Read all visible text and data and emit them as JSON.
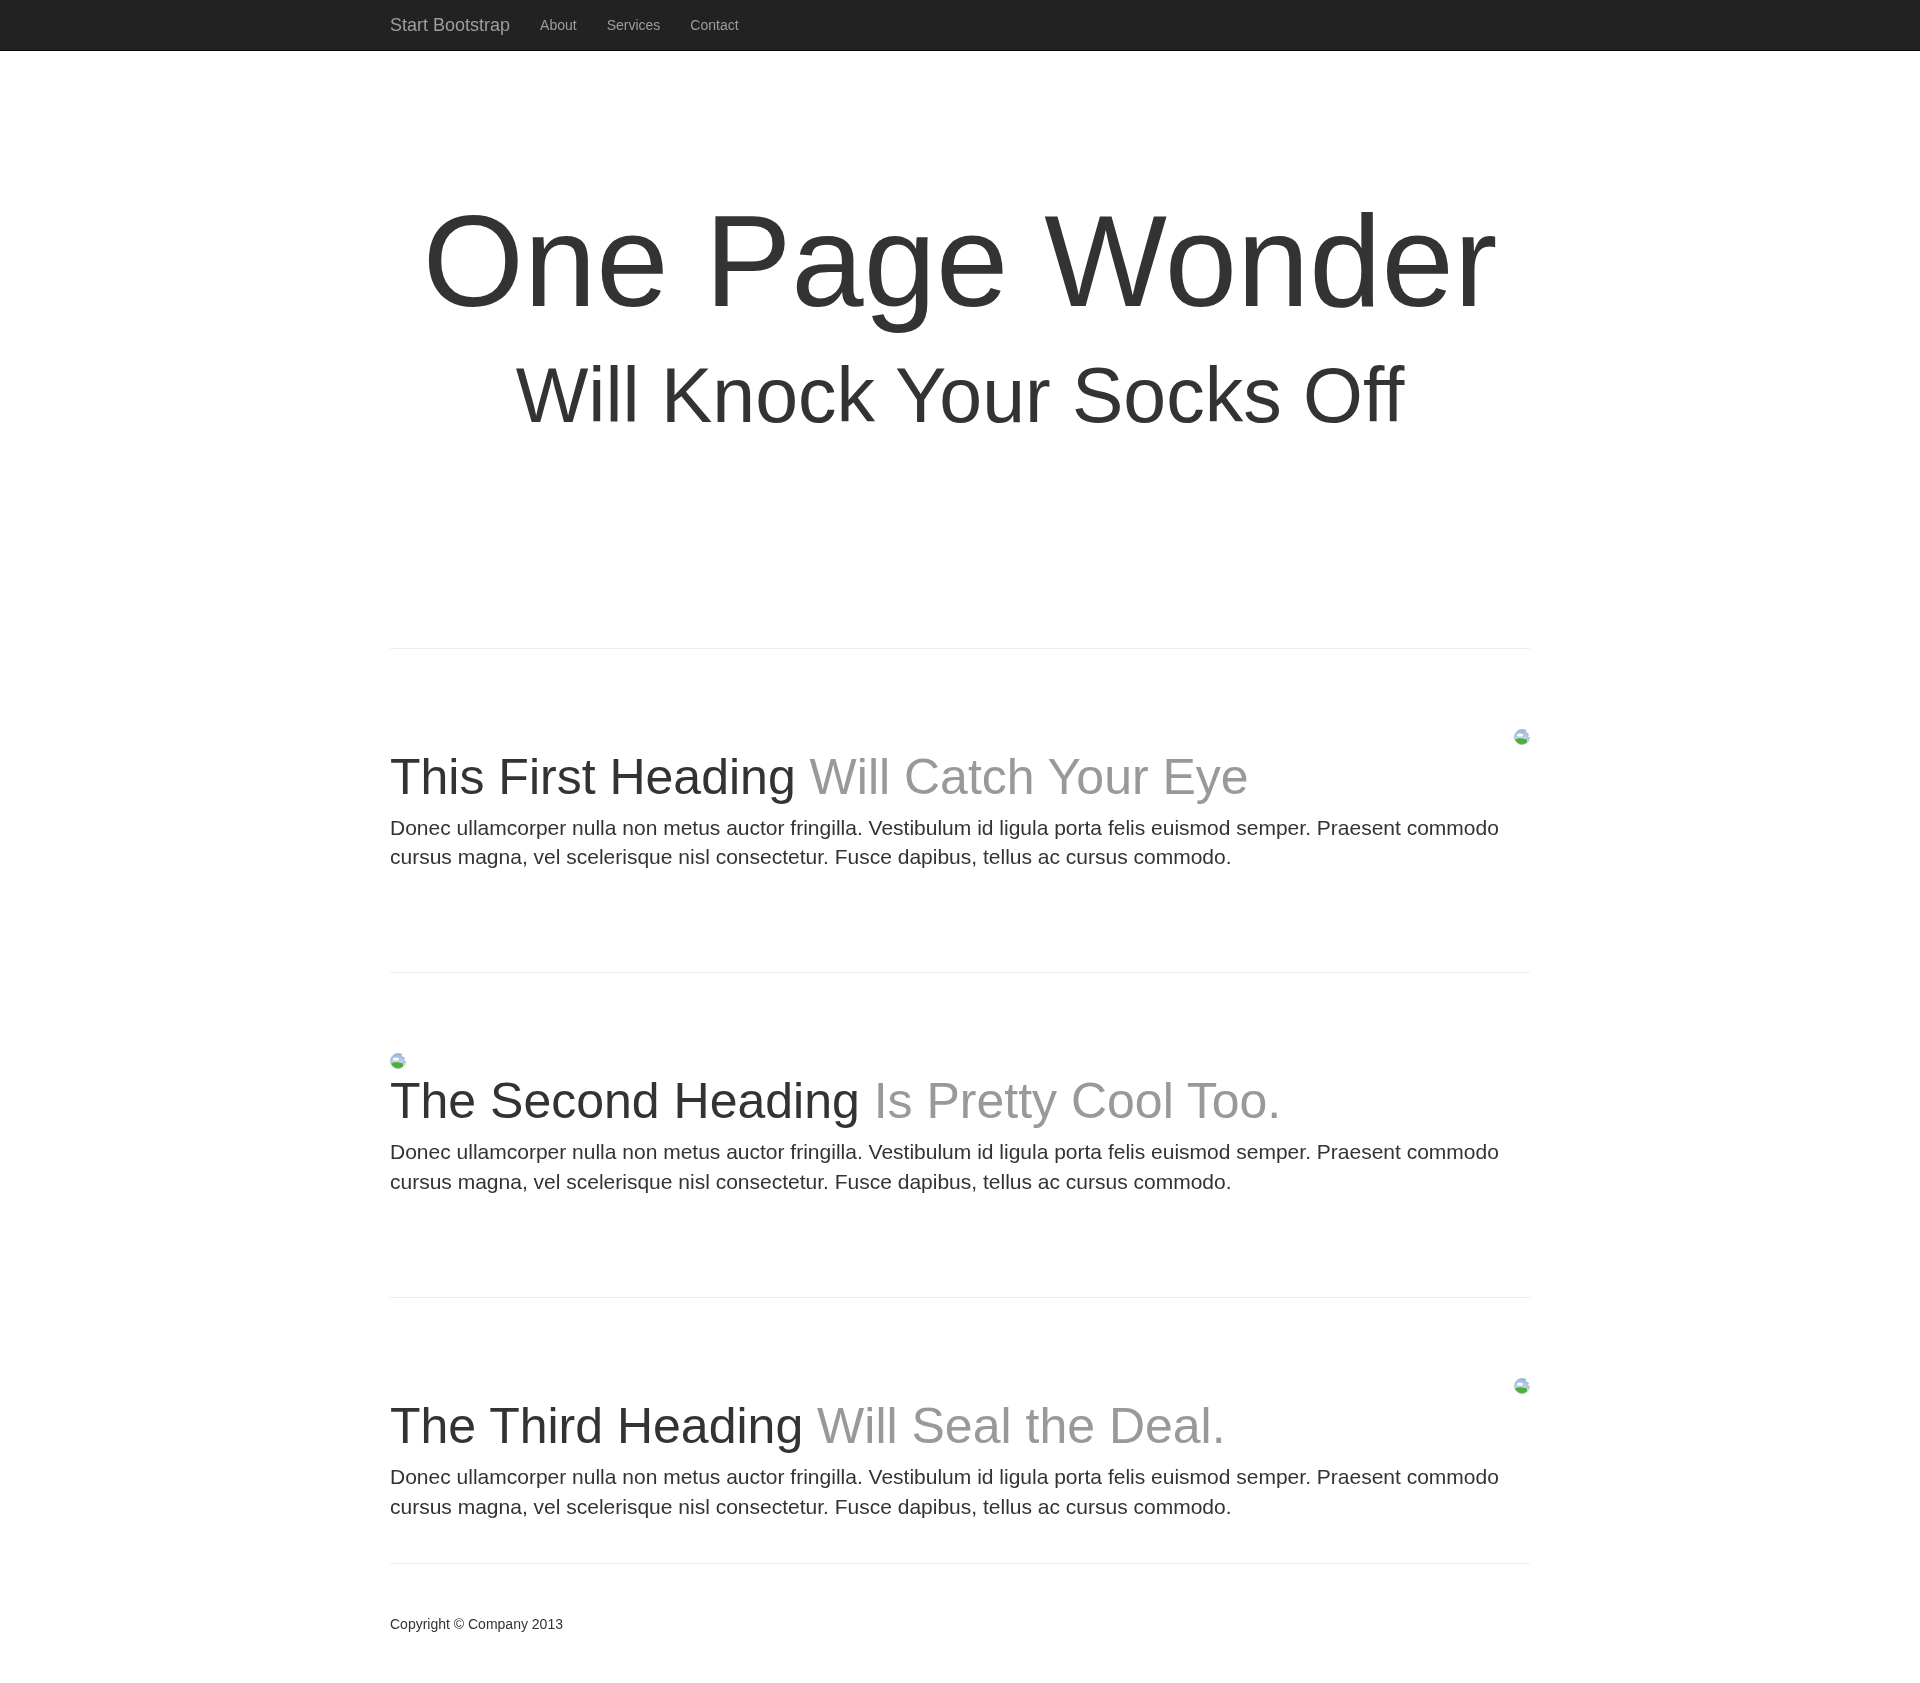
{
  "navbar": {
    "brand": "Start Bootstrap",
    "links": [
      {
        "label": "About"
      },
      {
        "label": "Services"
      },
      {
        "label": "Contact"
      }
    ]
  },
  "header": {
    "title": "One Page Wonder",
    "subtitle": "Will Knock Your Socks Off"
  },
  "sections": [
    {
      "kind": "right",
      "heading": "This First Heading",
      "heading_muted": "Will Catch Your Eye",
      "text": "Donec ullamcorper nulla non metus auctor fringilla. Vestibulum id ligula porta felis euismod semper. Praesent commodo cursus magna, vel scelerisque nisl consectetur. Fusce dapibus, tellus ac cursus commodo."
    },
    {
      "kind": "left",
      "heading": "The Second Heading",
      "heading_muted": "Is Pretty Cool Too.",
      "text": "Donec ullamcorper nulla non metus auctor fringilla. Vestibulum id ligula porta felis euismod semper. Praesent commodo cursus magna, vel scelerisque nisl consectetur. Fusce dapibus, tellus ac cursus commodo."
    },
    {
      "kind": "right",
      "heading": "The Third Heading",
      "heading_muted": "Will Seal the Deal.",
      "text": "Donec ullamcorper nulla non metus auctor fringilla. Vestibulum id ligula porta felis euismod semper. Praesent commodo cursus magna, vel scelerisque nisl consectetur. Fusce dapibus, tellus ac cursus commodo."
    }
  ],
  "footer": {
    "text": "Copyright © Company 2013"
  }
}
